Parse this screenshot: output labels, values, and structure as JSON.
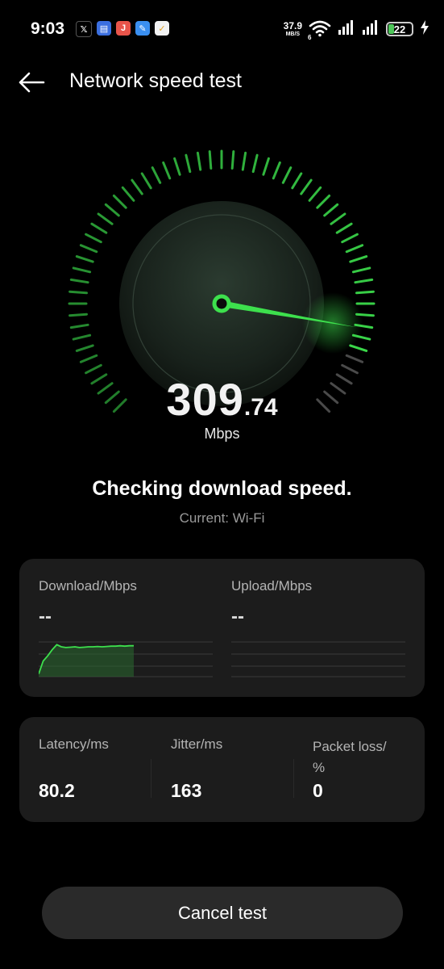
{
  "status_bar": {
    "time": "9:03",
    "app_icons": [
      {
        "name": "x-app-icon",
        "glyph": "𝕏",
        "color": "#000000"
      },
      {
        "name": "docs-app-icon",
        "glyph": "▤",
        "color": "#3b6fe0"
      },
      {
        "name": "j-app-icon",
        "glyph": "J",
        "color": "#e8544a"
      },
      {
        "name": "feather-app-icon",
        "glyph": "✎",
        "color": "#3a8ff0"
      },
      {
        "name": "check-app-icon",
        "glyph": "✓",
        "color": "#f2f2f2"
      }
    ],
    "net_speed_value": "37.9",
    "net_speed_unit": "MB/S",
    "wifi_badge": "6",
    "battery_level": "22",
    "battery_fraction": 0.22
  },
  "header": {
    "title": "Network speed test"
  },
  "gauge": {
    "speed_integer": "309",
    "speed_decimal": ".74",
    "unit": "Mbps",
    "needle_fraction": 0.87,
    "progress_fraction": 0.91,
    "accent_color": "#3de04d"
  },
  "status": {
    "title": "Checking download speed.",
    "connection": "Current: Wi-Fi"
  },
  "speed_card": {
    "download_label": "Download/Mbps",
    "download_value": "--",
    "upload_label": "Upload/Mbps",
    "upload_value": "--",
    "download_series": [
      0.08,
      0.45,
      0.6,
      0.78,
      0.92,
      0.86,
      0.84,
      0.85,
      0.86,
      0.84,
      0.85,
      0.86,
      0.86,
      0.87,
      0.86,
      0.87,
      0.88,
      0.88,
      0.89,
      0.88,
      0.89,
      0.89
    ]
  },
  "stats_card": {
    "latency_label": "Latency/ms",
    "latency_value": "80.2",
    "jitter_label": "Jitter/ms",
    "jitter_value": "163",
    "packet_loss_label_line1": "Packet loss/",
    "packet_loss_label_line2": "%",
    "packet_loss_value": "0"
  },
  "cancel_button": {
    "label": "Cancel test"
  }
}
